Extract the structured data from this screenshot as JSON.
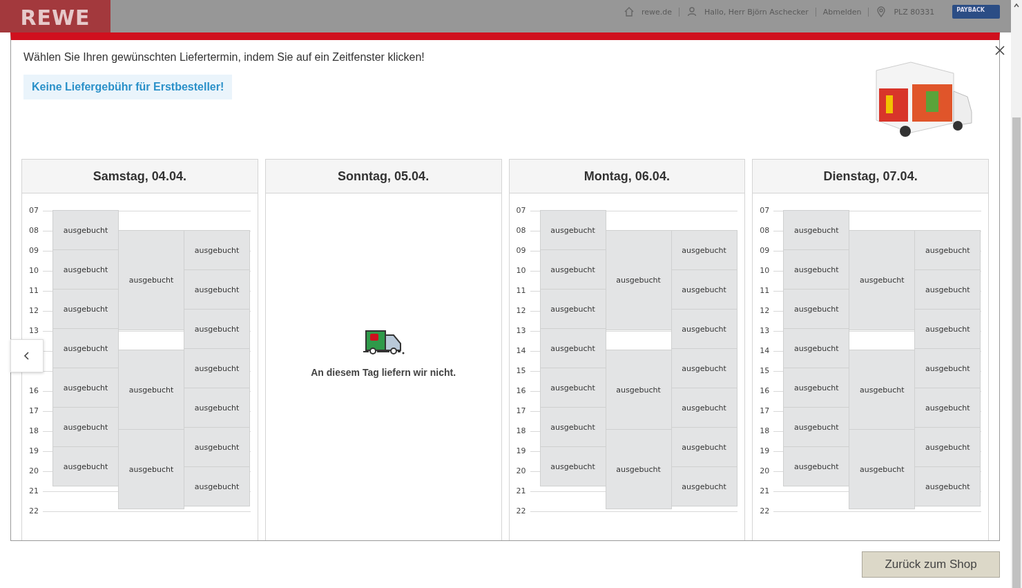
{
  "header": {
    "logo": "REWE",
    "links": [
      {
        "kind": "home",
        "label": "rewe.de"
      },
      {
        "kind": "user",
        "label": "Hallo, Herr Björn Aschecker"
      },
      {
        "kind": "plain",
        "label": "Abmelden"
      },
      {
        "kind": "location",
        "label": "PLZ 80331"
      }
    ],
    "badge": "PAYBACK"
  },
  "dialog": {
    "instruction": "Wählen Sie Ihren gewünschten Liefertermin, indem Sie auf ein Zeitfenster klicken!",
    "promo": "Keine Liefergebühr für Erstbesteller!",
    "days": [
      {
        "kind": "schedule",
        "title": "Samstag, 04.04.",
        "hours": [
          "07",
          "08",
          "09",
          "10",
          "11",
          "12",
          "13",
          {
            "kind": "covered"
          },
          {
            "kind": "covered"
          },
          "16",
          "17",
          "18",
          "19",
          "20",
          "21",
          "22"
        ],
        "columns": [
          [
            {
              "kind": "booked_2h",
              "label": "ausgebucht"
            },
            {
              "kind": "booked_2h",
              "label": "ausgebucht"
            },
            {
              "kind": "booked_2h",
              "label": "ausgebucht"
            },
            {
              "kind": "booked_2h",
              "label": "ausgebucht"
            },
            {
              "kind": "booked_2h",
              "label": "ausgebucht"
            },
            {
              "kind": "booked_2h",
              "label": "ausgebucht"
            },
            {
              "kind": "booked_2h",
              "label": "ausgebucht"
            }
          ],
          [
            {
              "kind": "free_1h"
            },
            {
              "kind": "booked_5h",
              "label": "ausgebucht"
            },
            {
              "kind": "free_1h"
            },
            {
              "kind": "booked_4h",
              "label": "ausgebucht"
            },
            {
              "kind": "booked_4h",
              "label": "ausgebucht"
            }
          ],
          [
            {
              "kind": "free_1h"
            },
            {
              "kind": "booked_2h",
              "label": "ausgebucht"
            },
            {
              "kind": "booked_2h",
              "label": "ausgebucht"
            },
            {
              "kind": "booked_2h",
              "label": "ausgebucht"
            },
            {
              "kind": "booked_2h",
              "label": "ausgebucht"
            },
            {
              "kind": "booked_2h",
              "label": "ausgebucht"
            },
            {
              "kind": "booked_2h",
              "label": "ausgebucht"
            },
            {
              "kind": "booked_2h",
              "label": "ausgebucht"
            }
          ]
        ]
      },
      {
        "kind": "closed",
        "title": "Sonntag, 05.04.",
        "message": "An diesem Tag liefern wir nicht."
      },
      {
        "kind": "schedule",
        "title": "Montag, 06.04.",
        "hours": [
          "07",
          "08",
          "09",
          "10",
          "11",
          "12",
          "13",
          "14",
          "15",
          "16",
          "17",
          "18",
          "19",
          "20",
          "21",
          "22"
        ],
        "columns": [
          [
            {
              "kind": "booked_2h",
              "label": "ausgebucht"
            },
            {
              "kind": "booked_2h",
              "label": "ausgebucht"
            },
            {
              "kind": "booked_2h",
              "label": "ausgebucht"
            },
            {
              "kind": "booked_2h",
              "label": "ausgebucht"
            },
            {
              "kind": "booked_2h",
              "label": "ausgebucht"
            },
            {
              "kind": "booked_2h",
              "label": "ausgebucht"
            },
            {
              "kind": "booked_2h",
              "label": "ausgebucht"
            }
          ],
          [
            {
              "kind": "free_1h"
            },
            {
              "kind": "booked_5h",
              "label": "ausgebucht"
            },
            {
              "kind": "free_1h"
            },
            {
              "kind": "booked_4h",
              "label": "ausgebucht"
            },
            {
              "kind": "booked_4h",
              "label": "ausgebucht"
            }
          ],
          [
            {
              "kind": "free_1h"
            },
            {
              "kind": "booked_2h",
              "label": "ausgebucht"
            },
            {
              "kind": "booked_2h",
              "label": "ausgebucht"
            },
            {
              "kind": "booked_2h",
              "label": "ausgebucht"
            },
            {
              "kind": "booked_2h",
              "label": "ausgebucht"
            },
            {
              "kind": "booked_2h",
              "label": "ausgebucht"
            },
            {
              "kind": "booked_2h",
              "label": "ausgebucht"
            },
            {
              "kind": "booked_2h",
              "label": "ausgebucht"
            }
          ]
        ]
      },
      {
        "kind": "schedule",
        "title": "Dienstag, 07.04.",
        "hours": [
          "07",
          "08",
          "09",
          "10",
          "11",
          "12",
          "13",
          "14",
          "15",
          "16",
          "17",
          "18",
          "19",
          "20",
          "21",
          "22"
        ],
        "columns": [
          [
            {
              "kind": "booked_2h",
              "label": "ausgebucht"
            },
            {
              "kind": "booked_2h",
              "label": "ausgebucht"
            },
            {
              "kind": "booked_2h",
              "label": "ausgebucht"
            },
            {
              "kind": "booked_2h",
              "label": "ausgebucht"
            },
            {
              "kind": "booked_2h",
              "label": "ausgebucht"
            },
            {
              "kind": "booked_2h",
              "label": "ausgebucht"
            },
            {
              "kind": "booked_2h",
              "label": "ausgebucht"
            }
          ],
          [
            {
              "kind": "free_1h"
            },
            {
              "kind": "booked_5h",
              "label": "ausgebucht"
            },
            {
              "kind": "free_1h"
            },
            {
              "kind": "booked_4h",
              "label": "ausgebucht"
            },
            {
              "kind": "booked_4h",
              "label": "ausgebucht"
            }
          ],
          [
            {
              "kind": "free_1h"
            },
            {
              "kind": "booked_2h",
              "label": "ausgebucht"
            },
            {
              "kind": "booked_2h",
              "label": "ausgebucht"
            },
            {
              "kind": "booked_2h",
              "label": "ausgebucht"
            },
            {
              "kind": "booked_2h",
              "label": "ausgebucht"
            },
            {
              "kind": "booked_2h",
              "label": "ausgebucht"
            },
            {
              "kind": "booked_2h",
              "label": "ausgebucht"
            },
            {
              "kind": "booked_2h",
              "label": "ausgebucht"
            }
          ]
        ]
      }
    ]
  },
  "back_button": "Zurück zum Shop"
}
